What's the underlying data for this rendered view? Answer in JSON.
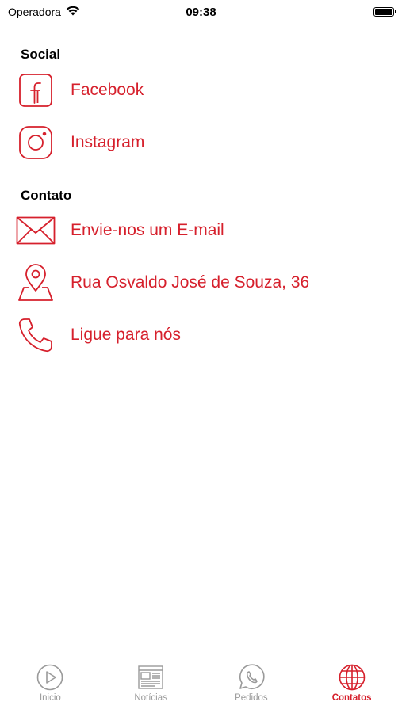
{
  "status_bar": {
    "carrier": "Operadora",
    "time": "09:38"
  },
  "colors": {
    "accent": "#d6202c",
    "tab_inactive": "#9a9a9a"
  },
  "sections": [
    {
      "title": "Social",
      "items": [
        {
          "label": "Facebook",
          "icon": "facebook-icon"
        },
        {
          "label": "Instagram",
          "icon": "instagram-icon"
        }
      ]
    },
    {
      "title": "Contato",
      "items": [
        {
          "label": "Envie-nos um E-mail",
          "icon": "mail-icon"
        },
        {
          "label": "Rua Osvaldo José de Souza, 36",
          "icon": "map-pin-icon"
        },
        {
          "label": "Ligue para nós",
          "icon": "phone-icon"
        }
      ]
    }
  ],
  "tab_bar": {
    "tabs": [
      {
        "label": "Inicio",
        "icon": "play-icon",
        "active": false
      },
      {
        "label": "Notícias",
        "icon": "newspaper-icon",
        "active": false
      },
      {
        "label": "Pedidos",
        "icon": "whatsapp-icon",
        "active": false
      },
      {
        "label": "Contatos",
        "icon": "globe-icon",
        "active": true
      }
    ]
  }
}
